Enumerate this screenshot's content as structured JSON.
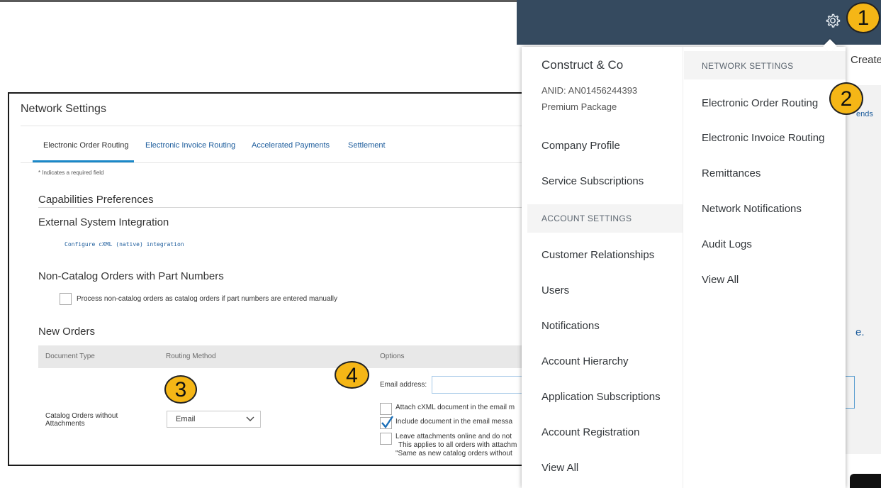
{
  "network_settings": {
    "title": "Network Settings",
    "tabs": [
      "Electronic Order Routing",
      "Electronic Invoice Routing",
      "Accelerated Payments",
      "Settlement"
    ],
    "required_note": "* Indicates a required field",
    "capabilities_heading": "Capabilities Preferences",
    "external_heading": "External System Integration",
    "configure_link": "Configure cXML (native) integration",
    "non_catalog_heading": "Non-Catalog Orders with Part Numbers",
    "non_catalog_checkbox_label": "Process non-catalog orders as catalog orders if part numbers are entered manually",
    "new_orders_heading": "New Orders",
    "table_headers": [
      "Document Type",
      "Routing Method",
      "Options"
    ],
    "row": {
      "document_type": "Catalog Orders without Attachments",
      "routing_method": "Email",
      "email_label": "Email address:",
      "options": [
        {
          "text": "Attach cXML document in the email m",
          "checked": false
        },
        {
          "text": "Include document in the email messa",
          "checked": true
        },
        {
          "text": "Leave attachments online and do not",
          "checked": false
        }
      ],
      "note_line1": "This applies to all orders with attachm",
      "note_line2": "\"Same as new catalog orders without"
    }
  },
  "badges": [
    "1",
    "2",
    "3",
    "4"
  ],
  "account_menu": {
    "company": "Construct & Co",
    "anid": "ANID: AN01456244393",
    "package": "Premium Package",
    "items_top": [
      "Company Profile",
      "Service Subscriptions"
    ],
    "account_settings_header": "ACCOUNT SETTINGS",
    "account_items": [
      "Customer Relationships",
      "Users",
      "Notifications",
      "Account Hierarchy",
      "Application Subscriptions",
      "Account Registration",
      "View All"
    ],
    "network_settings_header": "NETWORK SETTINGS",
    "network_items": [
      "Electronic Order Routing",
      "Electronic Invoice Routing",
      "Remittances",
      "Network Notifications",
      "Audit Logs",
      "View All"
    ]
  },
  "background_fragments": {
    "create": "Create",
    "ends": "ends",
    "e_text": "e."
  },
  "icons": {
    "settings": "gear-icon",
    "select": "chevron-down-icon",
    "check": "checkmark-icon"
  },
  "colors": {
    "topbar": "#354a5f",
    "badge": "#f5b616",
    "link": "#1c5c9c",
    "tab_underline": "#1b88c8"
  }
}
